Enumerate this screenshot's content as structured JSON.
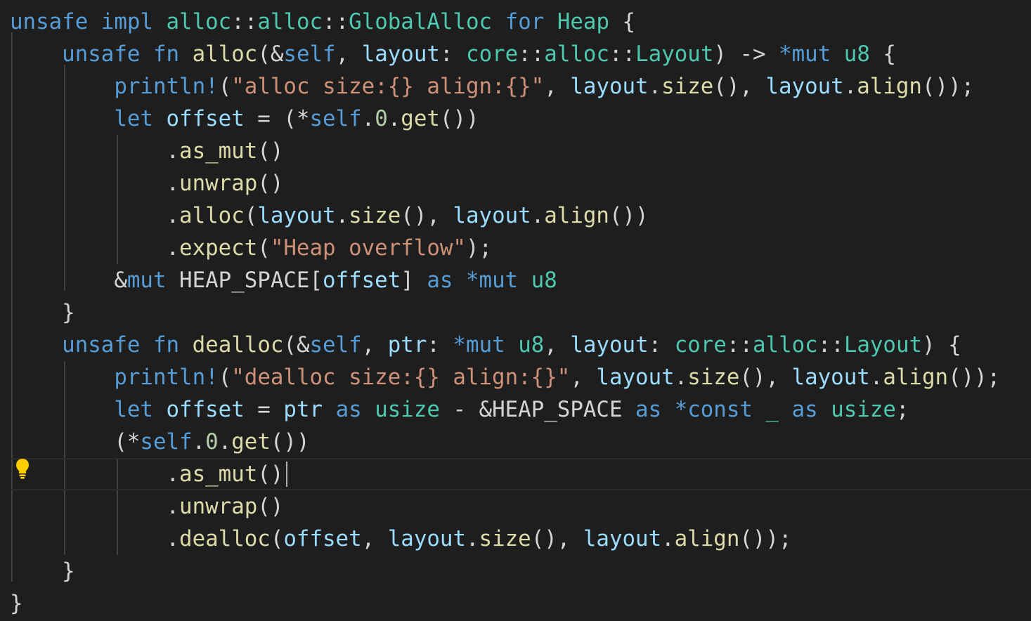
{
  "editor": {
    "colors": {
      "background": "#1e1e1e",
      "keyword": "#569cd6",
      "function": "#dcdcaa",
      "type": "#4ec9b0",
      "variable": "#9cdcfe",
      "string": "#ce9178",
      "number": "#b5cea8",
      "punctuation": "#d4d4d4",
      "lightbulb": "#ffcc00"
    },
    "gutter_icon": "lightbulb-icon",
    "lines": [
      [
        [
          "kw",
          "unsafe"
        ],
        [
          "pun",
          " "
        ],
        [
          "kw",
          "impl"
        ],
        [
          "pun",
          " "
        ],
        [
          "ty",
          "alloc"
        ],
        [
          "pun",
          "::"
        ],
        [
          "ty",
          "alloc"
        ],
        [
          "pun",
          "::"
        ],
        [
          "ty",
          "GlobalAlloc"
        ],
        [
          "pun",
          " "
        ],
        [
          "kw",
          "for"
        ],
        [
          "pun",
          " "
        ],
        [
          "ty",
          "Heap"
        ],
        [
          "pun",
          " {"
        ]
      ],
      [
        [
          "pun",
          "    "
        ],
        [
          "kw",
          "unsafe"
        ],
        [
          "pun",
          " "
        ],
        [
          "kw",
          "fn"
        ],
        [
          "pun",
          " "
        ],
        [
          "fn",
          "alloc"
        ],
        [
          "pun",
          "(&"
        ],
        [
          "kw",
          "self"
        ],
        [
          "pun",
          ", "
        ],
        [
          "var",
          "layout"
        ],
        [
          "pun",
          ": "
        ],
        [
          "ty",
          "core"
        ],
        [
          "pun",
          "::"
        ],
        [
          "ty",
          "alloc"
        ],
        [
          "pun",
          "::"
        ],
        [
          "ty",
          "Layout"
        ],
        [
          "pun",
          ") -> "
        ],
        [
          "kw",
          "*mut"
        ],
        [
          "pun",
          " "
        ],
        [
          "ty",
          "u8"
        ],
        [
          "pun",
          " {"
        ]
      ],
      [
        [
          "pun",
          "        "
        ],
        [
          "mac",
          "println!"
        ],
        [
          "pun",
          "("
        ],
        [
          "str",
          "\"alloc size:{} align:{}\""
        ],
        [
          "pun",
          ", "
        ],
        [
          "var",
          "layout"
        ],
        [
          "pun",
          "."
        ],
        [
          "fn",
          "size"
        ],
        [
          "pun",
          "(), "
        ],
        [
          "var",
          "layout"
        ],
        [
          "pun",
          "."
        ],
        [
          "fn",
          "align"
        ],
        [
          "pun",
          "());"
        ]
      ],
      [
        [
          "pun",
          "        "
        ],
        [
          "kw",
          "let"
        ],
        [
          "pun",
          " "
        ],
        [
          "var",
          "offset"
        ],
        [
          "pun",
          " = (*"
        ],
        [
          "kw",
          "self"
        ],
        [
          "pun",
          "."
        ],
        [
          "num",
          "0"
        ],
        [
          "pun",
          "."
        ],
        [
          "fn",
          "get"
        ],
        [
          "pun",
          "())"
        ]
      ],
      [
        [
          "pun",
          "            ."
        ],
        [
          "fn",
          "as_mut"
        ],
        [
          "pun",
          "()"
        ]
      ],
      [
        [
          "pun",
          "            ."
        ],
        [
          "fn",
          "unwrap"
        ],
        [
          "pun",
          "()"
        ]
      ],
      [
        [
          "pun",
          "            ."
        ],
        [
          "fn",
          "alloc"
        ],
        [
          "pun",
          "("
        ],
        [
          "var",
          "layout"
        ],
        [
          "pun",
          "."
        ],
        [
          "fn",
          "size"
        ],
        [
          "pun",
          "(), "
        ],
        [
          "var",
          "layout"
        ],
        [
          "pun",
          "."
        ],
        [
          "fn",
          "align"
        ],
        [
          "pun",
          "())"
        ]
      ],
      [
        [
          "pun",
          "            ."
        ],
        [
          "fn",
          "expect"
        ],
        [
          "pun",
          "("
        ],
        [
          "str",
          "\"Heap overflow\""
        ],
        [
          "pun",
          ");"
        ]
      ],
      [
        [
          "pun",
          "        &"
        ],
        [
          "kw",
          "mut"
        ],
        [
          "pun",
          " HEAP_SPACE["
        ],
        [
          "var",
          "offset"
        ],
        [
          "pun",
          "] "
        ],
        [
          "kw",
          "as"
        ],
        [
          "pun",
          " "
        ],
        [
          "kw",
          "*mut"
        ],
        [
          "pun",
          " "
        ],
        [
          "ty",
          "u8"
        ]
      ],
      [
        [
          "pun",
          "    }"
        ]
      ],
      [
        [
          "pun",
          "    "
        ],
        [
          "kw",
          "unsafe"
        ],
        [
          "pun",
          " "
        ],
        [
          "kw",
          "fn"
        ],
        [
          "pun",
          " "
        ],
        [
          "fn",
          "dealloc"
        ],
        [
          "pun",
          "(&"
        ],
        [
          "kw",
          "self"
        ],
        [
          "pun",
          ", "
        ],
        [
          "var",
          "ptr"
        ],
        [
          "pun",
          ": "
        ],
        [
          "kw",
          "*mut"
        ],
        [
          "pun",
          " "
        ],
        [
          "ty",
          "u8"
        ],
        [
          "pun",
          ", "
        ],
        [
          "var",
          "layout"
        ],
        [
          "pun",
          ": "
        ],
        [
          "ty",
          "core"
        ],
        [
          "pun",
          "::"
        ],
        [
          "ty",
          "alloc"
        ],
        [
          "pun",
          "::"
        ],
        [
          "ty",
          "Layout"
        ],
        [
          "pun",
          ") {"
        ]
      ],
      [
        [
          "pun",
          "        "
        ],
        [
          "mac",
          "println!"
        ],
        [
          "pun",
          "("
        ],
        [
          "str",
          "\"dealloc size:{} align:{}\""
        ],
        [
          "pun",
          ", "
        ],
        [
          "var",
          "layout"
        ],
        [
          "pun",
          "."
        ],
        [
          "fn",
          "size"
        ],
        [
          "pun",
          "(), "
        ],
        [
          "var",
          "layout"
        ],
        [
          "pun",
          "."
        ],
        [
          "fn",
          "align"
        ],
        [
          "pun",
          "());"
        ]
      ],
      [
        [
          "pun",
          "        "
        ],
        [
          "kw",
          "let"
        ],
        [
          "pun",
          " "
        ],
        [
          "var",
          "offset"
        ],
        [
          "pun",
          " = "
        ],
        [
          "var",
          "ptr"
        ],
        [
          "pun",
          " "
        ],
        [
          "kw",
          "as"
        ],
        [
          "pun",
          " "
        ],
        [
          "ty",
          "usize"
        ],
        [
          "pun",
          " - &HEAP_SPACE "
        ],
        [
          "kw",
          "as"
        ],
        [
          "pun",
          " "
        ],
        [
          "kw",
          "*const"
        ],
        [
          "pun",
          " "
        ],
        [
          "ty",
          "_"
        ],
        [
          "pun",
          " "
        ],
        [
          "kw",
          "as"
        ],
        [
          "pun",
          " "
        ],
        [
          "ty",
          "usize"
        ],
        [
          "pun",
          ";"
        ]
      ],
      [
        [
          "pun",
          "        (*"
        ],
        [
          "kw",
          "self"
        ],
        [
          "pun",
          "."
        ],
        [
          "num",
          "0"
        ],
        [
          "pun",
          "."
        ],
        [
          "fn",
          "get"
        ],
        [
          "pun",
          "())"
        ]
      ],
      [
        [
          "pun",
          "            ."
        ],
        [
          "fn",
          "as_mut"
        ],
        [
          "pun",
          "()"
        ]
      ],
      [
        [
          "pun",
          "            ."
        ],
        [
          "fn",
          "unwrap"
        ],
        [
          "pun",
          "()"
        ]
      ],
      [
        [
          "pun",
          "            ."
        ],
        [
          "fn",
          "dealloc"
        ],
        [
          "pun",
          "("
        ],
        [
          "var",
          "offset"
        ],
        [
          "pun",
          ", "
        ],
        [
          "var",
          "layout"
        ],
        [
          "pun",
          "."
        ],
        [
          "fn",
          "size"
        ],
        [
          "pun",
          "(), "
        ],
        [
          "var",
          "layout"
        ],
        [
          "pun",
          "."
        ],
        [
          "fn",
          "align"
        ],
        [
          "pun",
          "());"
        ]
      ],
      [
        [
          "pun",
          "    }"
        ]
      ],
      [
        [
          "pun",
          "}"
        ]
      ]
    ]
  }
}
